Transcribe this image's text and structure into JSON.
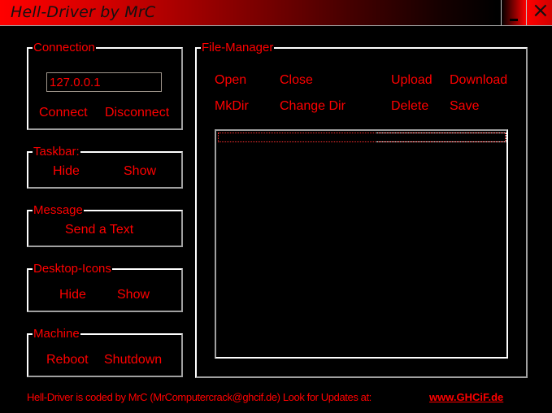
{
  "window": {
    "title": "Hell-Driver by MrC",
    "minimize_icon": "minimize-icon",
    "close_icon": "close-icon"
  },
  "connection": {
    "label": "Connection",
    "ip_value": "127.0.0.1",
    "connect_label": "Connect",
    "disconnect_label": "Disconnect"
  },
  "taskbar": {
    "label": "Taskbar:",
    "hide_label": "Hide",
    "show_label": "Show"
  },
  "message": {
    "label": "Message",
    "send_label": "Send a Text"
  },
  "desktop_icons": {
    "label": "Desktop-Icons",
    "hide_label": "Hide",
    "show_label": "Show"
  },
  "machine": {
    "label": "Machine",
    "reboot_label": "Reboot",
    "shutdown_label": "Shutdown"
  },
  "file_manager": {
    "label": "File-Manager",
    "buttons": {
      "open": "Open",
      "close": "Close",
      "upload": "Upload",
      "download": "Download",
      "mkdir": "MkDir",
      "change_dir": "Change Dir",
      "delete": "Delete",
      "save": "Save"
    },
    "files": []
  },
  "footer": {
    "text": "Hell-Driver is coded by MrC (MrComputercrack@ghcif.de)  Look for Updates  at:",
    "link": "www.GHCiF.de"
  },
  "colors": {
    "accent": "#ff0000",
    "background": "#000000",
    "border": "#c8c8c8"
  }
}
